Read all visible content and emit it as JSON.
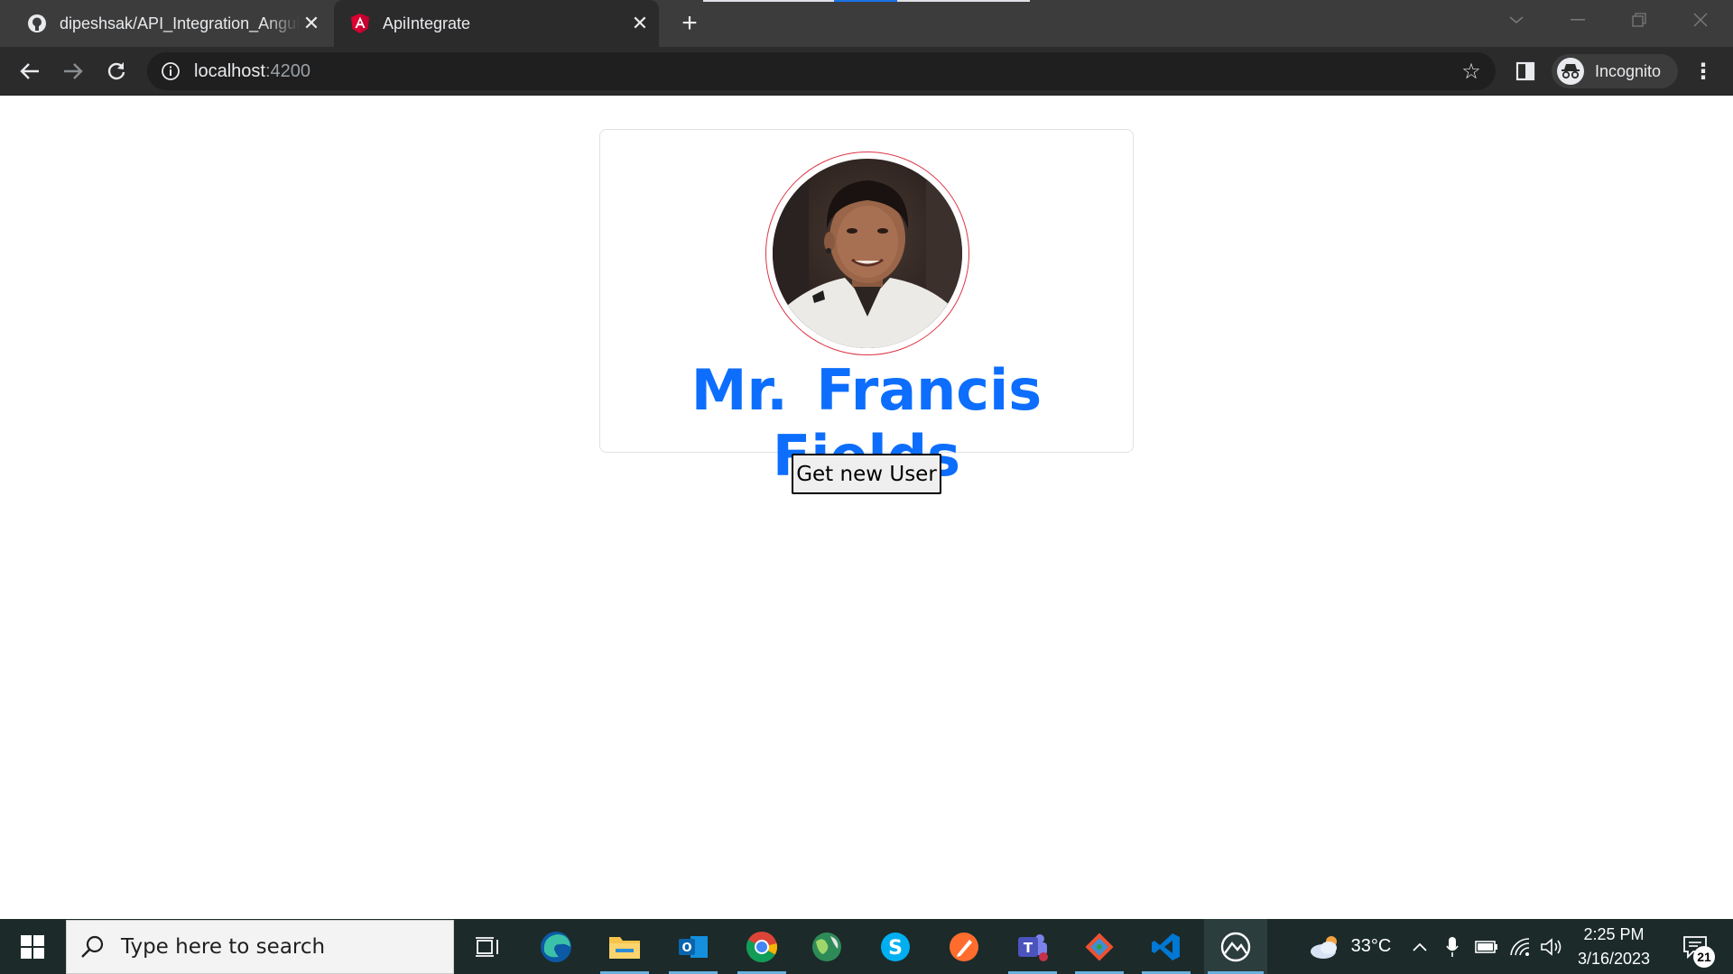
{
  "browser": {
    "tabs": [
      {
        "title": "dipeshsak/API_Integration_Angul",
        "favicon": "github-icon",
        "active": false
      },
      {
        "title": "ApiIntegrate",
        "favicon": "angular-icon",
        "active": true
      }
    ],
    "address": {
      "host": "localhost",
      "port": ":4200"
    },
    "profile_label": "Incognito"
  },
  "app": {
    "user_name": "Mr.  Francis  Fields",
    "avatar": "user-photo",
    "get_user_button": "Get new User"
  },
  "taskbar": {
    "search_placeholder": "Type here to search",
    "weather_temp": "33°C",
    "time": "2:25 PM",
    "date": "3/16/2023",
    "notification_count": "21",
    "apps": [
      "task-view-icon",
      "edge-icon",
      "file-explorer-icon",
      "outlook-icon",
      "chrome-icon",
      "globe-icon",
      "skype-icon",
      "pen-app-icon",
      "teams-icon",
      "git-icon",
      "vscode-icon",
      "game-app-icon"
    ]
  },
  "colors": {
    "name_color": "#0d6efd",
    "avatar_ring": "#dc3545",
    "tabstrip": "#3c3c3c",
    "toolbar": "#2b2b2b",
    "taskbar": "#1c2a2a"
  }
}
